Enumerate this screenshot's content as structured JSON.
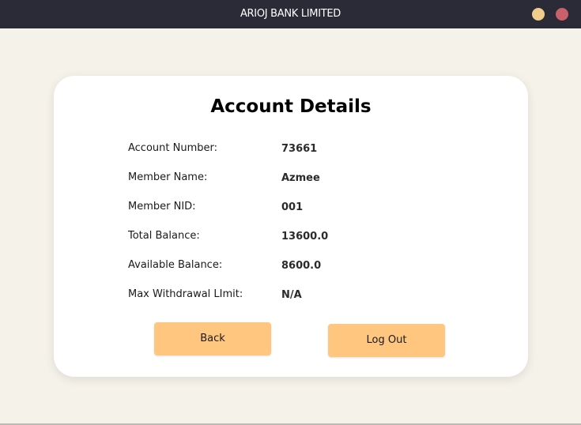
{
  "window": {
    "title": "ARIOJ BANK LIMITED",
    "controls": {
      "minimize_color": "#f0cd8b",
      "close_color": "#c9606a"
    }
  },
  "account": {
    "heading": "Account Details",
    "rows": [
      {
        "label": "Account Number:",
        "value": "73661"
      },
      {
        "label": "Member Name:",
        "value": "Azmee"
      },
      {
        "label": "Member NID:",
        "value": "001"
      },
      {
        "label": "Total Balance:",
        "value": "13600.0"
      },
      {
        "label": "Available Balance:",
        "value": "8600.0"
      },
      {
        "label": "Max Withdrawal LImit:",
        "value": "N/A"
      }
    ]
  },
  "actions": {
    "back_label": "Back",
    "logout_label": "Log Out"
  },
  "colors": {
    "titlebar": "#2b2b38",
    "background": "#f5f2ea",
    "button": "#fec67f"
  }
}
